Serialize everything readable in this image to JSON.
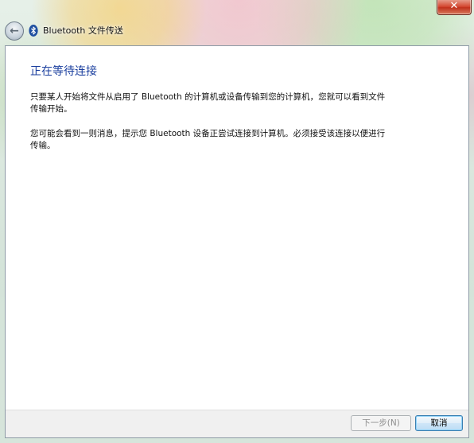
{
  "window": {
    "title": "Bluetooth 文件传送",
    "close_label": "✕",
    "back_label": "←",
    "icons": {
      "back": "back-arrow-icon",
      "app": "bluetooth-icon"
    }
  },
  "main": {
    "heading": "正在等待连接",
    "paragraph1": "只要某人开始将文件从启用了 Bluetooth 的计算机或设备传输到您的计算机，您就可以看到文件传输开始。",
    "paragraph2": "您可能会看到一则消息，提示您 Bluetooth 设备正尝试连接到计算机。必须接受该连接以便进行传输。"
  },
  "footer": {
    "next_label": "下一步(N)",
    "cancel_label": "取消"
  },
  "colors": {
    "heading": "#1a3e9e",
    "close_button": "#c0311c"
  }
}
